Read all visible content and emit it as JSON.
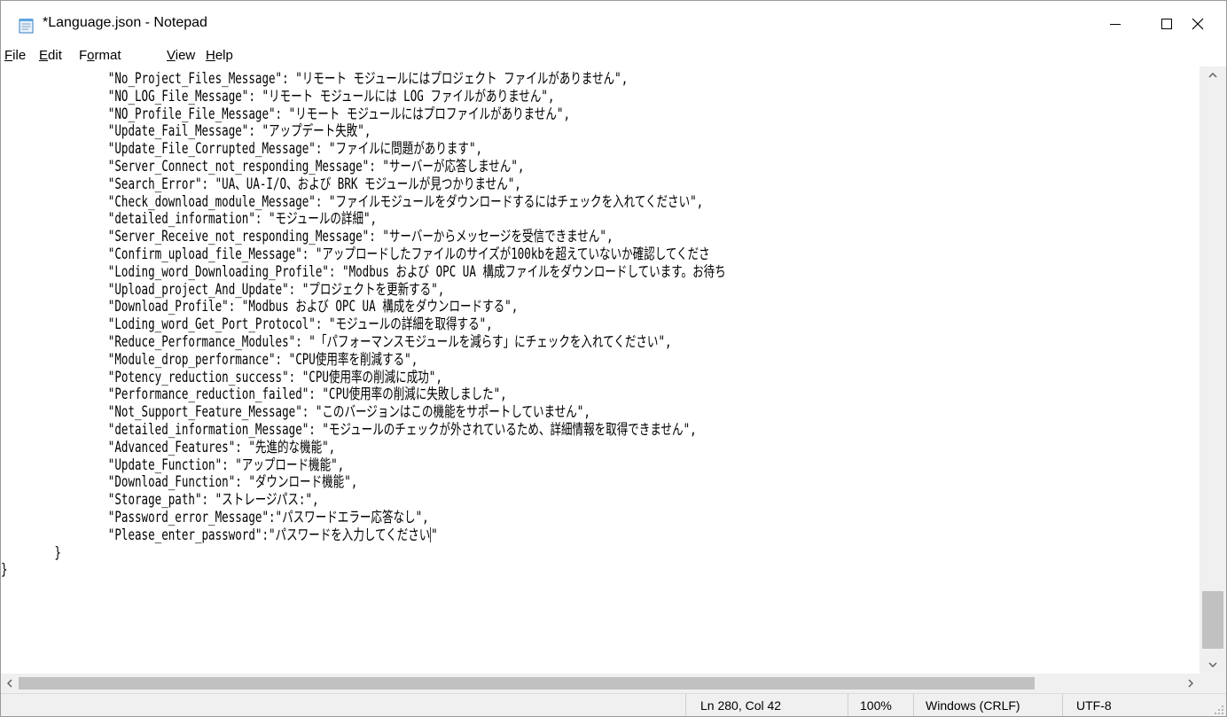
{
  "window": {
    "title": "*Language.json - Notepad",
    "icon": "notepad-icon"
  },
  "menu": {
    "items": [
      {
        "label": "File",
        "accel": "F",
        "rest": "ile"
      },
      {
        "label": "Edit",
        "accel": "E",
        "rest": "dit"
      },
      {
        "label": "Format",
        "pre": "F",
        "accel": "o",
        "rest": "rmat"
      },
      {
        "label": "View",
        "accel": "V",
        "rest": "iew"
      },
      {
        "label": "Help",
        "accel": "H",
        "rest": "elp"
      }
    ]
  },
  "editor": {
    "lines": [
      "                \"No_Project_Files_Message\": \"リモート モジュールにはプロジェクト ファイルがありません\",",
      "                \"NO_LOG_File_Message\": \"リモート モジュールには LOG ファイルがありません\",",
      "                \"NO_Profile_File_Message\": \"リモート モジュールにはプロファイルがありません\",",
      "                \"Update_Fail_Message\": \"アップデート失敗\",",
      "                \"Update_File_Corrupted_Message\": \"ファイルに問題があります\",",
      "                \"Server_Connect_not_responding_Message\": \"サーバーが応答しません\",",
      "                \"Search_Error\": \"UA、UA-I/O、および BRK モジュールが見つかりません\",",
      "                \"Check_download_module_Message\": \"ファイルモジュールをダウンロードするにはチェックを入れてください\",",
      "                \"detailed_information\": \"モジュールの詳細\",",
      "                \"Server_Receive_not_responding_Message\": \"サーバーからメッセージを受信できません\",",
      "                \"Confirm_upload_file_Message\": \"アップロードしたファイルのサイズが100kbを超えていないか確認してくださ",
      "                \"Loding_word_Downloading_Profile\": \"Modbus および OPC UA 構成ファイルをダウンロードしています。お待ち",
      "                \"Upload_project_And_Update\": \"プロジェクトを更新する\",",
      "                \"Download_Profile\": \"Modbus および OPC UA 構成をダウンロードする\",",
      "                \"Loding_word_Get_Port_Protocol\": \"モジュールの詳細を取得する\",",
      "                \"Reduce_Performance_Modules\": \"「パフォーマンスモジュールを減らす」にチェックを入れてください\",",
      "                \"Module_drop_performance\": \"CPU使用率を削減する\",",
      "                \"Potency_reduction_success\": \"CPU使用率の削減に成功\",",
      "                \"Performance_reduction_failed\": \"CPU使用率の削減に失敗しました\",",
      "                \"Not_Support_Feature_Message\": \"このバージョンはこの機能をサポートしていません\",",
      "                \"detailed_information_Message\": \"モジュールのチェックが外されているため、詳細情報を取得できません\",",
      "                \"Advanced_Features\": \"先進的な機能\",",
      "                \"Update_Function\": \"アップロード機能\",",
      "                \"Download_Function\": \"ダウンロード機能\",",
      "                \"Storage_path\": \"ストレージパス:\",",
      "                \"Password_error_Message\":\"パスワードエラー応答なし\",",
      "                \"Please_enter_password\":\"パスワードを入力してください\"",
      "        }",
      "}"
    ],
    "caret_line": 26
  },
  "status": {
    "position": "Ln 280, Col 42",
    "zoom": "100%",
    "line_ending": "Windows (CRLF)",
    "encoding": "UTF-8"
  }
}
